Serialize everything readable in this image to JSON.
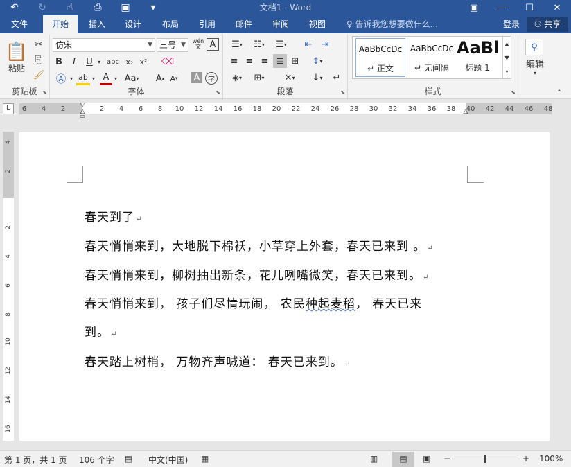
{
  "window": {
    "title": "文档1 - Word"
  },
  "tabs": [
    {
      "label": "文件"
    },
    {
      "label": "开始"
    },
    {
      "label": "插入"
    },
    {
      "label": "设计"
    },
    {
      "label": "布局"
    },
    {
      "label": "引用"
    },
    {
      "label": "邮件"
    },
    {
      "label": "审阅"
    },
    {
      "label": "视图"
    }
  ],
  "tellme": {
    "placeholder": "告诉我您想要做什么..."
  },
  "account": {
    "login": "登录",
    "share": "共享"
  },
  "ribbon": {
    "clipboard": {
      "label": "剪贴板",
      "paste": "粘贴"
    },
    "font": {
      "label": "字体",
      "font_name": "仿宋",
      "font_size": "三号",
      "phonetic": "wén",
      "bold": "B",
      "italic": "I",
      "underline": "U",
      "strike": "abc",
      "subscript": "x₂",
      "superscript": "x²",
      "grow": "A",
      "shrink": "A",
      "case": "Aa",
      "char_shading": "A",
      "color_a": "A"
    },
    "paragraph": {
      "label": "段落"
    },
    "styles": {
      "label": "样式",
      "items": [
        {
          "sample": "AaBbCcDc",
          "name": "↵ 正文"
        },
        {
          "sample": "AaBbCcDc",
          "name": "↵ 无间隔"
        },
        {
          "sample": "AaBl",
          "name": "标题 1"
        }
      ]
    },
    "editing": {
      "label": "编辑"
    }
  },
  "ruler": {
    "corner": "L",
    "left_numbers": [
      "6",
      "4",
      "2"
    ],
    "numbers": [
      "2",
      "4",
      "6",
      "8",
      "10",
      "12",
      "14",
      "16",
      "18",
      "20",
      "22",
      "24",
      "26",
      "28",
      "30",
      "32",
      "34",
      "36",
      "38"
    ],
    "right_numbers": [
      "40",
      "42",
      "44",
      "46",
      "48"
    ],
    "vertical": [
      "4",
      "2",
      "2",
      "4",
      "6",
      "8",
      "10",
      "12",
      "14",
      "16"
    ]
  },
  "document": {
    "paragraphs": [
      {
        "text": "春天到了",
        "mark": "↵"
      },
      {
        "text": "春天悄悄来到，大地脱下棉袄，小草穿上外套，春天已来到 。",
        "mark": "↵"
      },
      {
        "text": "春天悄悄来到，柳树抽出新条，花儿咧嘴微笑，春天已来到。",
        "mark": "↵"
      },
      {
        "text_pre": "春天悄悄来到， 孩子们尽情玩闹， 农民",
        "text_squig": "种起麦稻",
        "text_post": "， 春天已来"
      },
      {
        "text": "到。",
        "mark": "↵"
      },
      {
        "text": "春天踏上树梢， 万物齐声喊道： 春天已来到。",
        "mark": "↵"
      }
    ]
  },
  "status": {
    "page": "第 1 页，共 1 页",
    "words": "106 个字",
    "language": "中文(中国)",
    "zoom": "100%"
  }
}
